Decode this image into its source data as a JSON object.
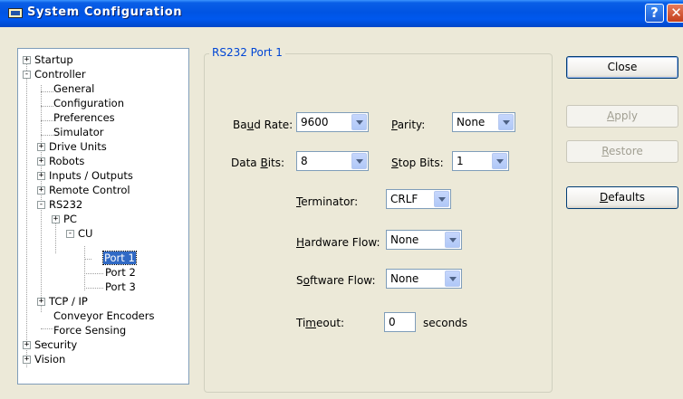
{
  "window": {
    "title": "System Configuration"
  },
  "tree": {
    "items": [
      {
        "label": "Startup",
        "expander": "+"
      },
      {
        "label": "Controller",
        "expander": "-"
      },
      {
        "label": "General"
      },
      {
        "label": "Configuration"
      },
      {
        "label": "Preferences"
      },
      {
        "label": "Simulator"
      },
      {
        "label": "Drive Units",
        "expander": "+"
      },
      {
        "label": "Robots",
        "expander": "+"
      },
      {
        "label": "Inputs / Outputs",
        "expander": "+"
      },
      {
        "label": "Remote Control",
        "expander": "+"
      },
      {
        "label": "RS232",
        "expander": "-"
      },
      {
        "label": "PC",
        "expander": "+"
      },
      {
        "label": "CU",
        "expander": "-"
      },
      {
        "label": "Port 1",
        "selected": true
      },
      {
        "label": "Port 2"
      },
      {
        "label": "Port 3"
      },
      {
        "label": "TCP / IP",
        "expander": "+"
      },
      {
        "label": "Conveyor Encoders"
      },
      {
        "label": "Force Sensing"
      },
      {
        "label": "Security",
        "expander": "+"
      },
      {
        "label": "Vision",
        "expander": "+"
      }
    ]
  },
  "panel": {
    "group_title": "RS232 Port 1",
    "baud_rate": {
      "label_pre": "Ba",
      "label_u": "u",
      "label_post": "d Rate:",
      "value": "9600"
    },
    "parity": {
      "label_pre": "",
      "label_u": "P",
      "label_post": "arity:",
      "value": "None"
    },
    "data_bits": {
      "label_pre": "Data ",
      "label_u": "B",
      "label_post": "its:",
      "value": "8"
    },
    "stop_bits": {
      "label_pre": "",
      "label_u": "S",
      "label_post": "top Bits:",
      "value": "1"
    },
    "terminator": {
      "label_pre": "",
      "label_u": "T",
      "label_post": "erminator:",
      "value": "CRLF"
    },
    "hardware_flow": {
      "label_pre": "",
      "label_u": "H",
      "label_post": "ardware Flow:",
      "value": "None"
    },
    "software_flow": {
      "label_pre": "S",
      "label_u": "o",
      "label_post": "ftware Flow:",
      "value": "None"
    },
    "timeout": {
      "label_pre": "Ti",
      "label_u": "m",
      "label_post": "eout:",
      "value": "0",
      "unit": "seconds"
    }
  },
  "buttons": {
    "close": "Close",
    "apply": {
      "u": "A",
      "rest": "pply"
    },
    "restore": {
      "u": "R",
      "rest": "estore"
    },
    "defaults": {
      "u": "D",
      "rest": "efaults"
    }
  }
}
